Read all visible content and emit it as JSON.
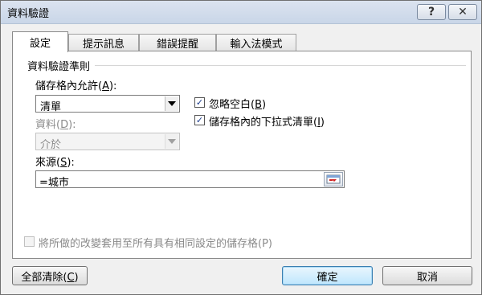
{
  "window": {
    "title": "資料驗證"
  },
  "titlebar": {
    "help_label": "?",
    "close_label": "✕"
  },
  "tabs": [
    {
      "label": "設定",
      "active": true
    },
    {
      "label": "提示訊息",
      "active": false
    },
    {
      "label": "錯誤提醒",
      "active": false
    },
    {
      "label": "輸入法模式",
      "active": false
    }
  ],
  "settings": {
    "section_title": "資料驗證準則",
    "allow_label": "儲存格內允許(",
    "allow_key": "A",
    "allow_label_end": "):",
    "allow_value": "清單",
    "data_label": "資料(",
    "data_key": "D",
    "data_label_end": "):",
    "data_value": "介於",
    "ignore_blank_label": "忽略空白(",
    "ignore_blank_key": "B",
    "ignore_blank_end": ")",
    "ignore_blank_checked": true,
    "dropdown_label": "儲存格內的下拉式清單(",
    "dropdown_key": "I",
    "dropdown_end": ")",
    "dropdown_checked": true,
    "source_label": "來源(",
    "source_key": "S",
    "source_label_end": "):",
    "source_value": "=城市",
    "apply_all_label": "將所做的改變套用至所有具有相同設定的儲存格(P)",
    "apply_all_checked": false
  },
  "footer": {
    "clear_all_label": "全部清除(",
    "clear_all_key": "C",
    "clear_all_end": ")",
    "ok_label": "確定",
    "cancel_label": "取消"
  }
}
